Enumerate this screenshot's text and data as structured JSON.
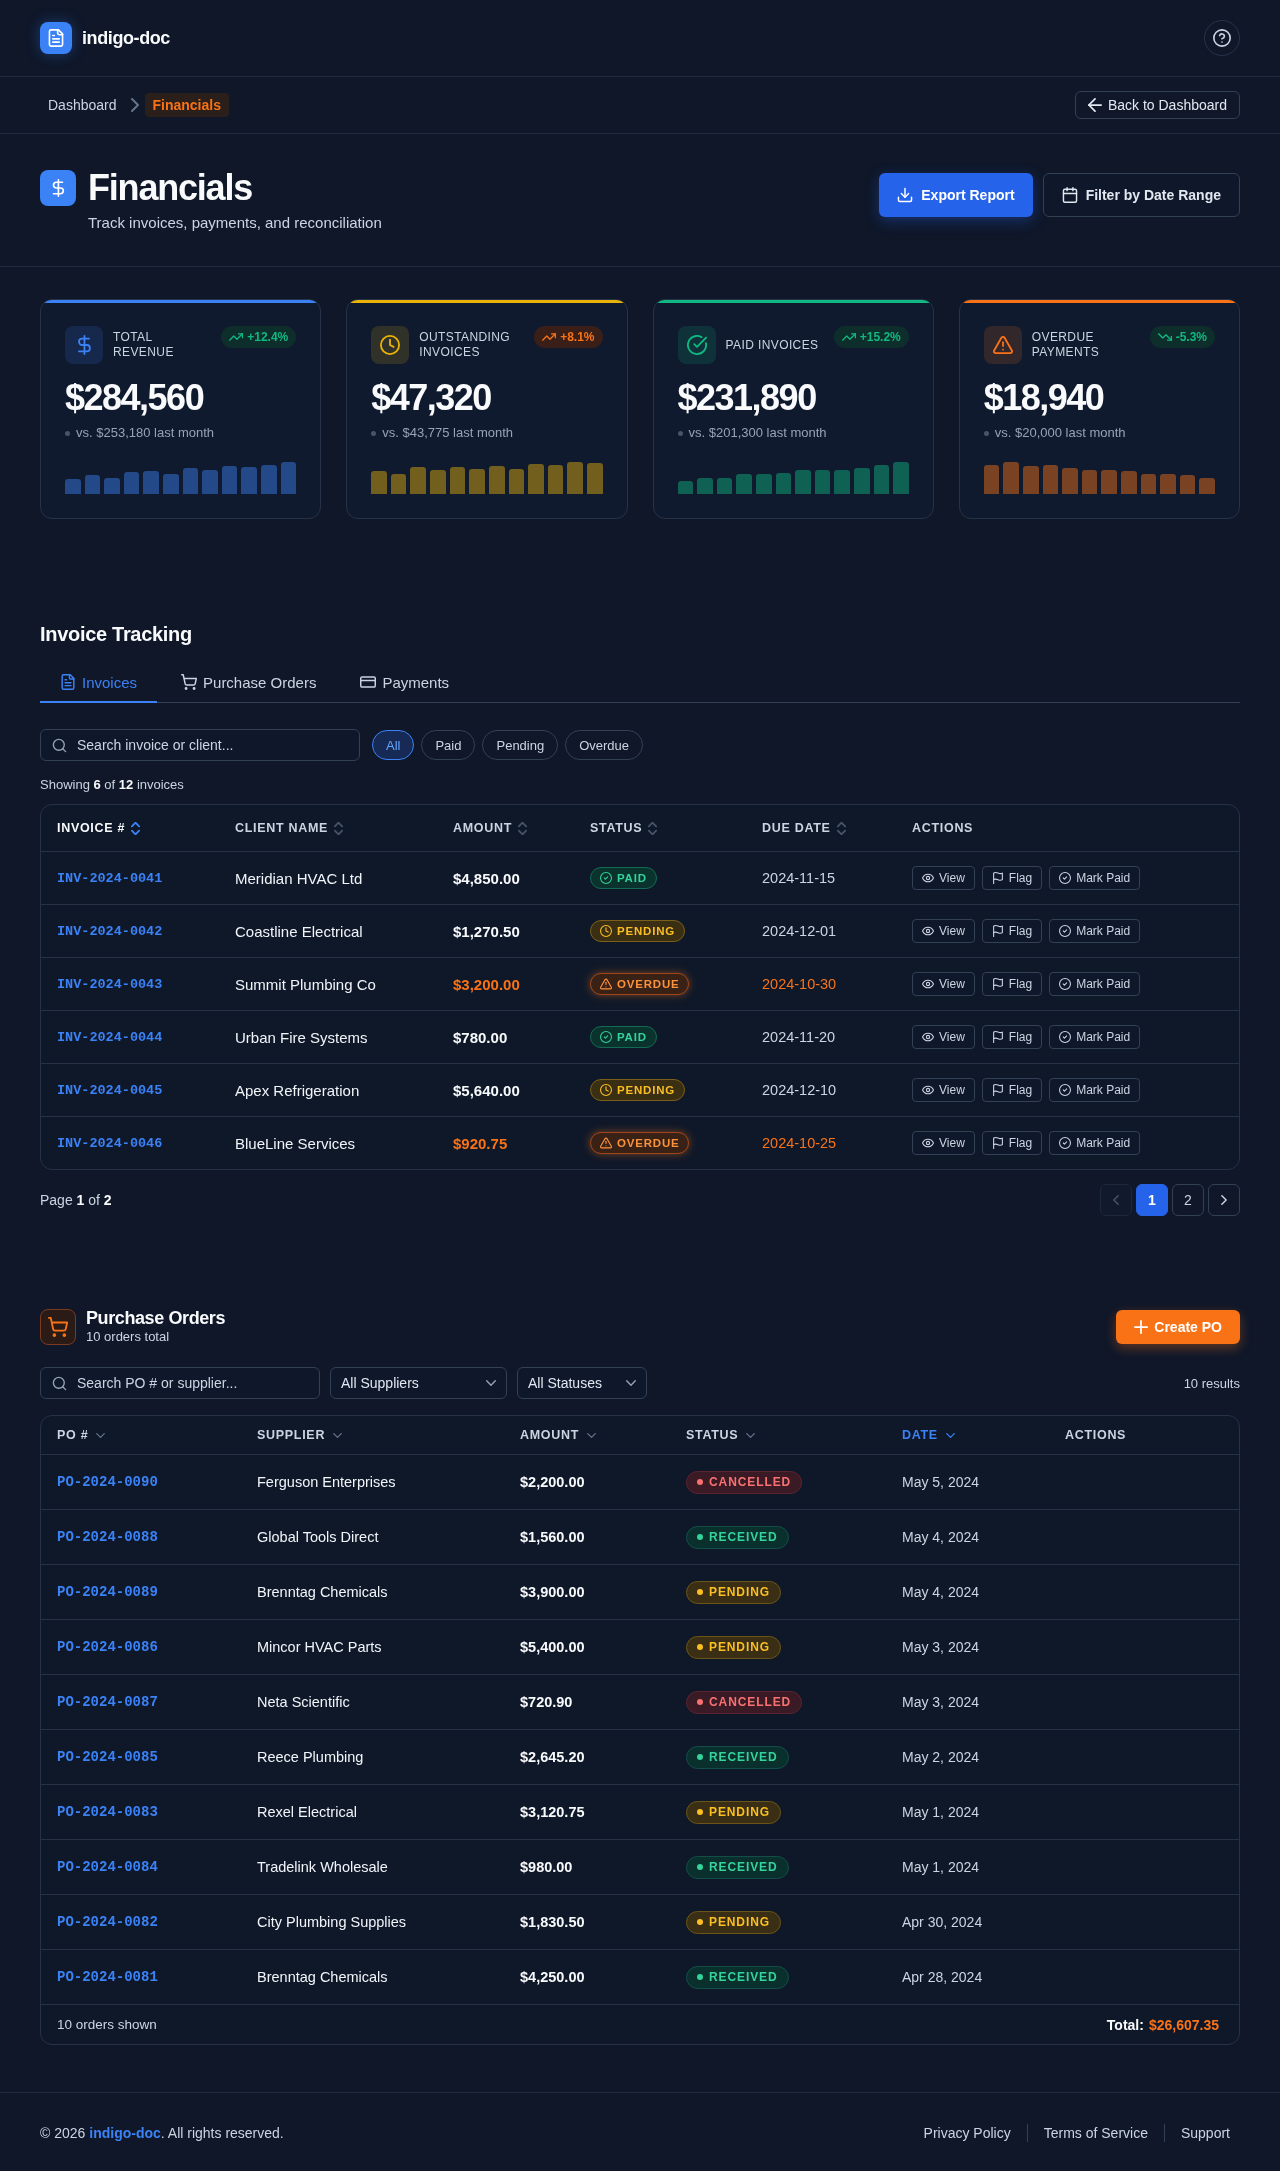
{
  "header": {
    "app_name": "indigo-doc"
  },
  "breadcrumb": {
    "items": [
      {
        "label": "Dashboard",
        "current": false
      },
      {
        "label": "Financials",
        "current": true
      }
    ],
    "back_button": "Back to Dashboard"
  },
  "page_header": {
    "title": "Financials",
    "subtitle": "Track invoices, payments, and reconciliation",
    "actions": [
      {
        "label": "Export Report",
        "kind": "export"
      },
      {
        "label": "Filter by Date Range",
        "kind": "date_filter"
      }
    ]
  },
  "kpis": [
    {
      "kind": "revenue",
      "label": "TOTAL REVENUE",
      "value": "$284,560",
      "comparison": "vs. $253,180 last month",
      "change": "+12.4%",
      "rising": true,
      "favorable": true,
      "color": "#3b82f6"
    },
    {
      "kind": "outstanding",
      "label": "OUTSTANDING INVOICES",
      "value": "$47,320",
      "comparison": "vs. $43,775 last month",
      "change": "+8.1%",
      "rising": true,
      "favorable": false,
      "color": "#eab308"
    },
    {
      "kind": "paid",
      "label": "PAID INVOICES",
      "value": "$231,890",
      "comparison": "vs. $201,300 last month",
      "change": "+15.2%",
      "rising": true,
      "favorable": true,
      "color": "#10b981"
    },
    {
      "kind": "overdue",
      "label": "OVERDUE PAYMENTS",
      "value": "$18,940",
      "comparison": "vs. $20,000 last month",
      "change": "-5.3%",
      "rising": false,
      "favorable": true,
      "color": "#f97316"
    }
  ],
  "invoice_tracking": {
    "title": "Invoice Tracking",
    "tabs": [
      {
        "label": "Invoices",
        "kind": "invoices",
        "selected": true
      },
      {
        "label": "Purchase Orders",
        "kind": "purchase_orders",
        "selected": false
      },
      {
        "label": "Payments",
        "kind": "payments",
        "selected": false
      }
    ],
    "search": {
      "placeholder": "Search invoice or client..."
    },
    "filters": [
      {
        "label": "All",
        "selected": true
      },
      {
        "label": "Paid",
        "selected": false
      },
      {
        "label": "Pending",
        "selected": false
      },
      {
        "label": "Overdue",
        "selected": false
      }
    ],
    "summary": "Showing **6** of **12** invoices",
    "table": {
      "columns": [
        {
          "label": "INVOICE #",
          "sortable": true,
          "active": true
        },
        {
          "label": "CLIENT NAME",
          "sortable": true,
          "active": false
        },
        {
          "label": "AMOUNT",
          "sortable": true,
          "active": false
        },
        {
          "label": "STATUS",
          "sortable": true,
          "active": false
        },
        {
          "label": "DUE DATE",
          "sortable": true,
          "active": false
        },
        {
          "label": "ACTIONS",
          "sortable": false,
          "active": false
        }
      ],
      "rows": [
        {
          "invoice": "INV-2024-0041",
          "client": "Meridian HVAC Ltd",
          "amount": "$4,850.00",
          "status": {
            "label": "PAID",
            "kind": "paid"
          },
          "due_date": "2024-11-15",
          "actions": [
            {
              "label": "View",
              "kind": "view"
            },
            {
              "label": "Flag",
              "kind": "flag"
            },
            {
              "label": "Mark Paid",
              "kind": "mark_paid"
            }
          ]
        },
        {
          "invoice": "INV-2024-0042",
          "client": "Coastline Electrical",
          "amount": "$1,270.50",
          "status": {
            "label": "PENDING",
            "kind": "pending"
          },
          "due_date": "2024-12-01",
          "actions": [
            {
              "label": "View",
              "kind": "view"
            },
            {
              "label": "Flag",
              "kind": "flag"
            },
            {
              "label": "Mark Paid",
              "kind": "mark_paid"
            }
          ]
        },
        {
          "invoice": "INV-2024-0043",
          "client": "Summit Plumbing Co",
          "amount": "$3,200.00",
          "status": {
            "label": "OVERDUE",
            "kind": "overdue"
          },
          "due_date": "2024-10-30",
          "actions": [
            {
              "label": "View",
              "kind": "view"
            },
            {
              "label": "Flag",
              "kind": "flag"
            },
            {
              "label": "Mark Paid",
              "kind": "mark_paid"
            }
          ]
        },
        {
          "invoice": "INV-2024-0044",
          "client": "Urban Fire Systems",
          "amount": "$780.00",
          "status": {
            "label": "PAID",
            "kind": "paid"
          },
          "due_date": "2024-11-20",
          "actions": [
            {
              "label": "View",
              "kind": "view"
            },
            {
              "label": "Flag",
              "kind": "flag"
            },
            {
              "label": "Mark Paid",
              "kind": "mark_paid"
            }
          ]
        },
        {
          "invoice": "INV-2024-0045",
          "client": "Apex Refrigeration",
          "amount": "$5,640.00",
          "status": {
            "label": "PENDING",
            "kind": "pending"
          },
          "due_date": "2024-12-10",
          "actions": [
            {
              "label": "View",
              "kind": "view"
            },
            {
              "label": "Flag",
              "kind": "flag"
            },
            {
              "label": "Mark Paid",
              "kind": "mark_paid"
            }
          ]
        },
        {
          "invoice": "INV-2024-0046",
          "client": "BlueLine Services",
          "amount": "$920.75",
          "status": {
            "label": "OVERDUE",
            "kind": "overdue"
          },
          "due_date": "2024-10-25",
          "actions": [
            {
              "label": "View",
              "kind": "view"
            },
            {
              "label": "Flag",
              "kind": "flag"
            },
            {
              "label": "Mark Paid",
              "kind": "mark_paid"
            }
          ]
        }
      ]
    },
    "pagination": {
      "summary": "Page **1** of **2**",
      "previous": {
        "disabled": true
      },
      "pages": [
        {
          "label": "1",
          "selected": true
        },
        {
          "label": "2",
          "selected": false
        }
      ],
      "next": {
        "disabled": false
      }
    }
  },
  "purchase_orders": {
    "title": "Purchase Orders",
    "subtitle": "10 orders total",
    "create_button": "Create PO",
    "search": {
      "placeholder": "Search PO # or supplier..."
    },
    "selects": [
      {
        "value": "All Suppliers"
      },
      {
        "value": "All Statuses"
      }
    ],
    "result_count": "10 results",
    "table": {
      "columns": [
        {
          "label": "PO #",
          "sortable": true,
          "active": false
        },
        {
          "label": "SUPPLIER",
          "sortable": true,
          "active": false
        },
        {
          "label": "AMOUNT",
          "sortable": true,
          "active": false
        },
        {
          "label": "STATUS",
          "sortable": true,
          "active": false
        },
        {
          "label": "DATE",
          "sortable": true,
          "active": true
        },
        {
          "label": "ACTIONS",
          "sortable": false,
          "active": false
        }
      ],
      "rows": [
        {
          "po": "PO-2024-0090",
          "supplier": "Ferguson Enterprises",
          "amount": "$2,200.00",
          "status": {
            "label": "CANCELLED",
            "kind": "cancelled"
          },
          "date": "May 5, 2024"
        },
        {
          "po": "PO-2024-0088",
          "supplier": "Global Tools Direct",
          "amount": "$1,560.00",
          "status": {
            "label": "RECEIVED",
            "kind": "received"
          },
          "date": "May 4, 2024"
        },
        {
          "po": "PO-2024-0089",
          "supplier": "Brenntag Chemicals",
          "amount": "$3,900.00",
          "status": {
            "label": "PENDING",
            "kind": "pending"
          },
          "date": "May 4, 2024"
        },
        {
          "po": "PO-2024-0086",
          "supplier": "Mincor HVAC Parts",
          "amount": "$5,400.00",
          "status": {
            "label": "PENDING",
            "kind": "pending"
          },
          "date": "May 3, 2024"
        },
        {
          "po": "PO-2024-0087",
          "supplier": "Neta Scientific",
          "amount": "$720.90",
          "status": {
            "label": "CANCELLED",
            "kind": "cancelled"
          },
          "date": "May 3, 2024"
        },
        {
          "po": "PO-2024-0085",
          "supplier": "Reece Plumbing",
          "amount": "$2,645.20",
          "status": {
            "label": "RECEIVED",
            "kind": "received"
          },
          "date": "May 2, 2024"
        },
        {
          "po": "PO-2024-0083",
          "supplier": "Rexel Electrical",
          "amount": "$3,120.75",
          "status": {
            "label": "PENDING",
            "kind": "pending"
          },
          "date": "May 1, 2024"
        },
        {
          "po": "PO-2024-0084",
          "supplier": "Tradelink Wholesale",
          "amount": "$980.00",
          "status": {
            "label": "RECEIVED",
            "kind": "received"
          },
          "date": "May 1, 2024"
        },
        {
          "po": "PO-2024-0082",
          "supplier": "City Plumbing Supplies",
          "amount": "$1,830.50",
          "status": {
            "label": "PENDING",
            "kind": "pending"
          },
          "date": "Apr 30, 2024"
        },
        {
          "po": "PO-2024-0081",
          "supplier": "Brenntag Chemicals",
          "amount": "$4,250.00",
          "status": {
            "label": "RECEIVED",
            "kind": "received"
          },
          "date": "Apr 28, 2024"
        }
      ],
      "footer": {
        "count": "10 orders shown",
        "total_label": "Total:",
        "total_value": "$26,607.35"
      }
    }
  },
  "footer": {
    "copyright": {
      "before": "© 2026",
      "link": "indigo-doc",
      "after": ". All rights reserved."
    },
    "links": [
      "Privacy Policy",
      "Terms of Service",
      "Support"
    ]
  }
}
